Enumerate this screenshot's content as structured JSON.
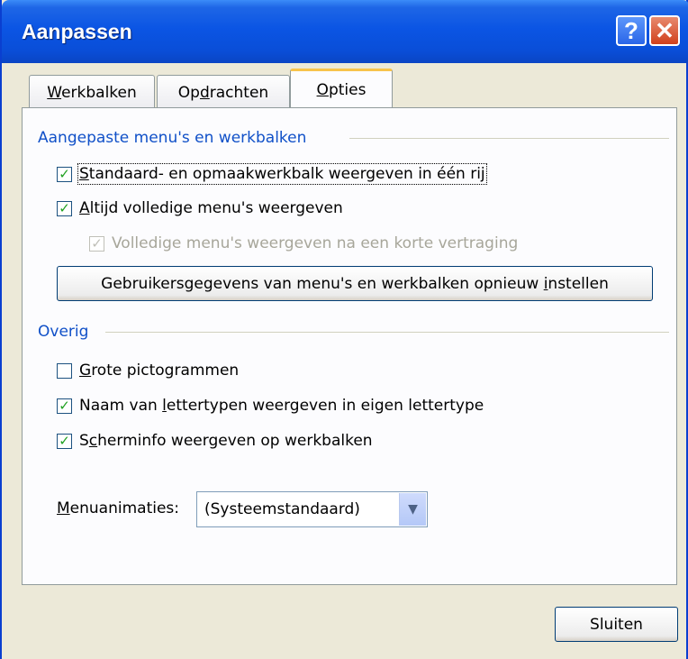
{
  "window": {
    "title": "Aanpassen",
    "help_icon": "question-mark",
    "close_icon": "x"
  },
  "tabs": [
    {
      "label_pre": "",
      "label_key": "W",
      "label_post": "erkbalken",
      "active": false
    },
    {
      "label_pre": "Op",
      "label_key": "d",
      "label_post": "rachten",
      "active": false
    },
    {
      "label_pre": "",
      "label_key": "O",
      "label_post": "pties",
      "active": true
    }
  ],
  "custom_menus": {
    "title": "Aangepaste menu's en werkbalken",
    "options": [
      {
        "key": "S",
        "label": "tandaard- en opmaakwerkbalk weergeven in één rij",
        "checked": true,
        "enabled": true
      },
      {
        "key": "A",
        "label": "ltijd volledige menu's weergeven",
        "checked": true,
        "enabled": true
      },
      {
        "key": "",
        "label": "Volledige menu's weergeven na een korte vertraging",
        "checked": true,
        "enabled": false
      }
    ],
    "reset_button": {
      "pre": "Gebruikersgegevens van menu's en werkbalken opnieuw ",
      "key": "i",
      "post": "nstellen"
    }
  },
  "other": {
    "title": "Overig",
    "options": [
      {
        "pre": "",
        "key": "G",
        "post": "rote pictogrammen",
        "checked": false
      },
      {
        "pre": "Naam van ",
        "key": "l",
        "post": "ettertypen weergeven in eigen lettertype",
        "checked": true
      },
      {
        "pre": "S",
        "key": "c",
        "post": "herminfo weergeven op werkbalken",
        "checked": true
      }
    ]
  },
  "menu_animations": {
    "label_key": "M",
    "label_rest": "enuanimaties:",
    "value": "(Systeemstandaard)"
  },
  "footer": {
    "close_button": "Sluiten"
  },
  "colors": {
    "titlebar": "#0b55e4",
    "group_title": "#1050c8",
    "check": "#21a121",
    "active_tab_accent": "#f7c34b"
  }
}
